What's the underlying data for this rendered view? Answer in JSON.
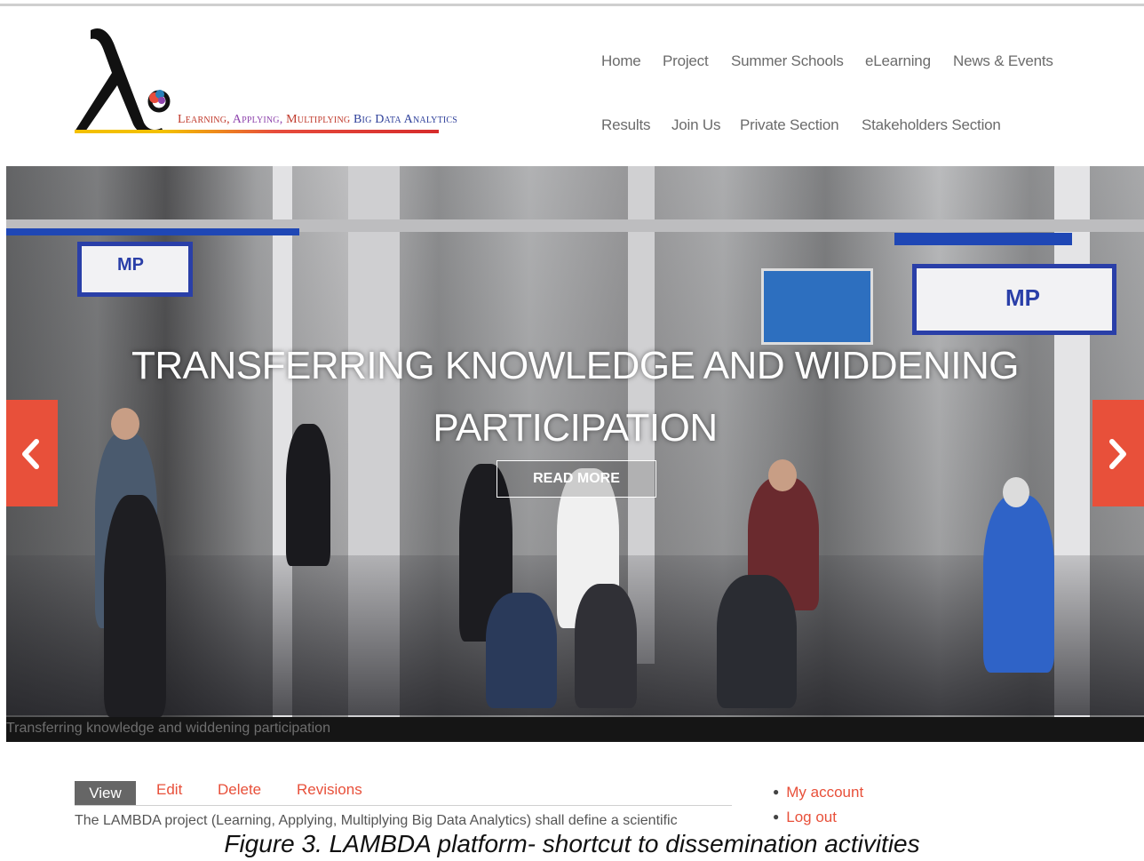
{
  "logo": {
    "tagline_words": [
      "Learning,",
      "Applying,",
      "Multiplying",
      "Big Data Analytics"
    ]
  },
  "nav": {
    "row1": [
      "Home",
      "Project",
      "Summer Schools",
      "eLearning",
      "News & Events"
    ],
    "row2": [
      "Results",
      "Join Us",
      "Private Section",
      "Stakeholders Section"
    ]
  },
  "hero": {
    "title_line1": "TRANSFERRING KNOWLEDGE AND WIDDENING",
    "title_line2": "PARTICIPATION",
    "button": "READ MORE",
    "caption": "Transferring knowledge and widdening participation",
    "sign_text": "MP",
    "accent_color": "#e8503a"
  },
  "tabs": {
    "view": "View",
    "edit": "Edit",
    "delete": "Delete",
    "revisions": "Revisions"
  },
  "content": {
    "body_text": "The LAMBDA project (Learning, Applying, Multiplying Big Data Analytics) shall define a scientific"
  },
  "account_menu": {
    "my_account": "My account",
    "log_out": "Log out"
  },
  "figure_caption": "Figure 3. LAMBDA platform- shortcut to dissemination activities"
}
